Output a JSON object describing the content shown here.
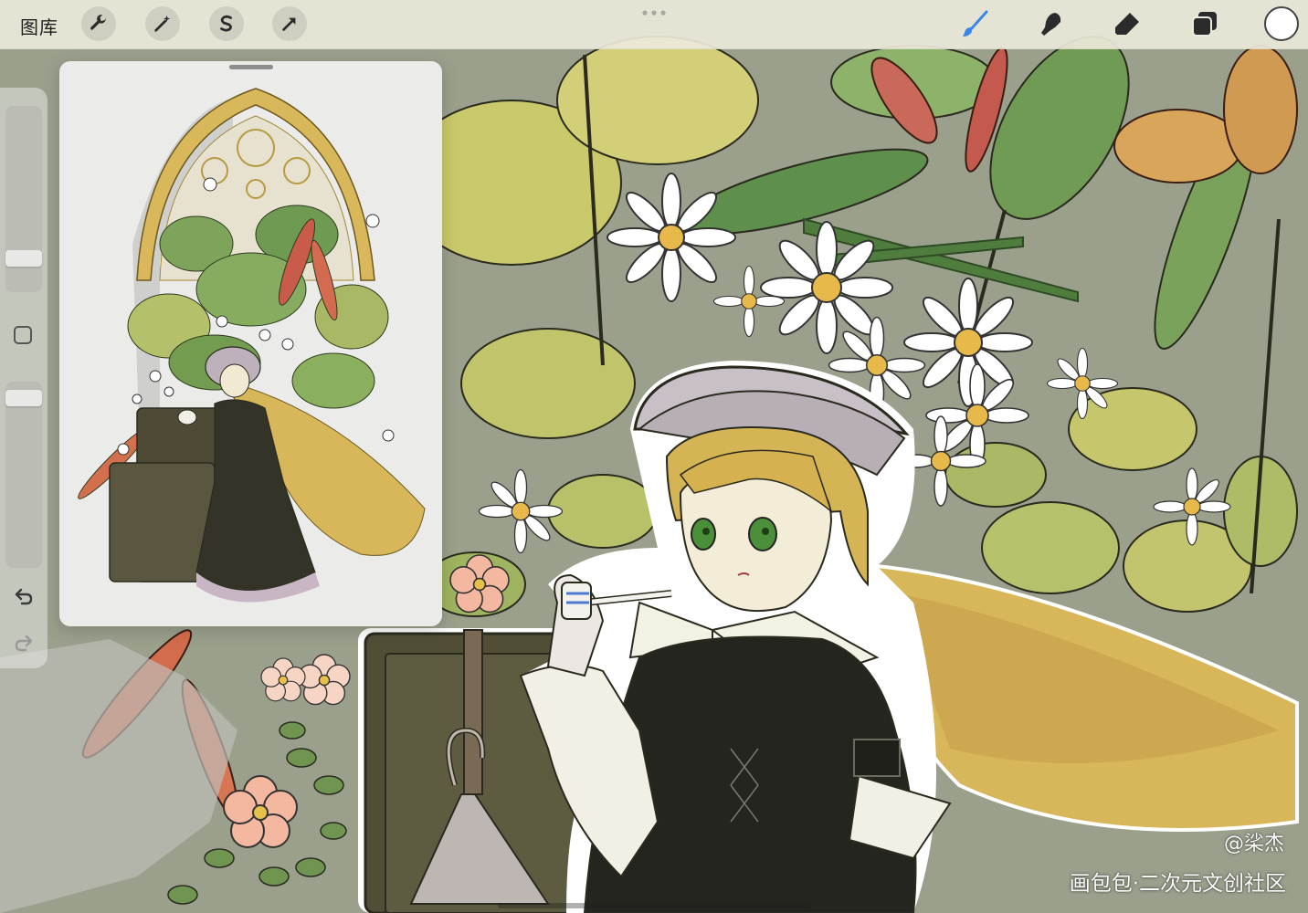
{
  "toolbar": {
    "gallery_label": "图库",
    "left_tools": [
      "wrench-icon",
      "magic-wand-icon",
      "selection-s-icon",
      "transform-arrow-icon"
    ],
    "right_tools": [
      "brush-icon",
      "smudge-icon",
      "eraser-icon",
      "layers-icon"
    ],
    "active_tool": "brush",
    "current_color": "#ffffff",
    "brush_active_color": "#3b86ea"
  },
  "sidebar": {
    "brush_size_level": 0.15,
    "opacity_level": 0.95,
    "icons": [
      "modify-square-icon",
      "undo-icon",
      "redo-icon"
    ]
  },
  "reference_window": {
    "content": "reference-artwork-thumbnail"
  },
  "watermark": {
    "author": "@桬杰",
    "site": "画包包·二次元文创社区"
  }
}
